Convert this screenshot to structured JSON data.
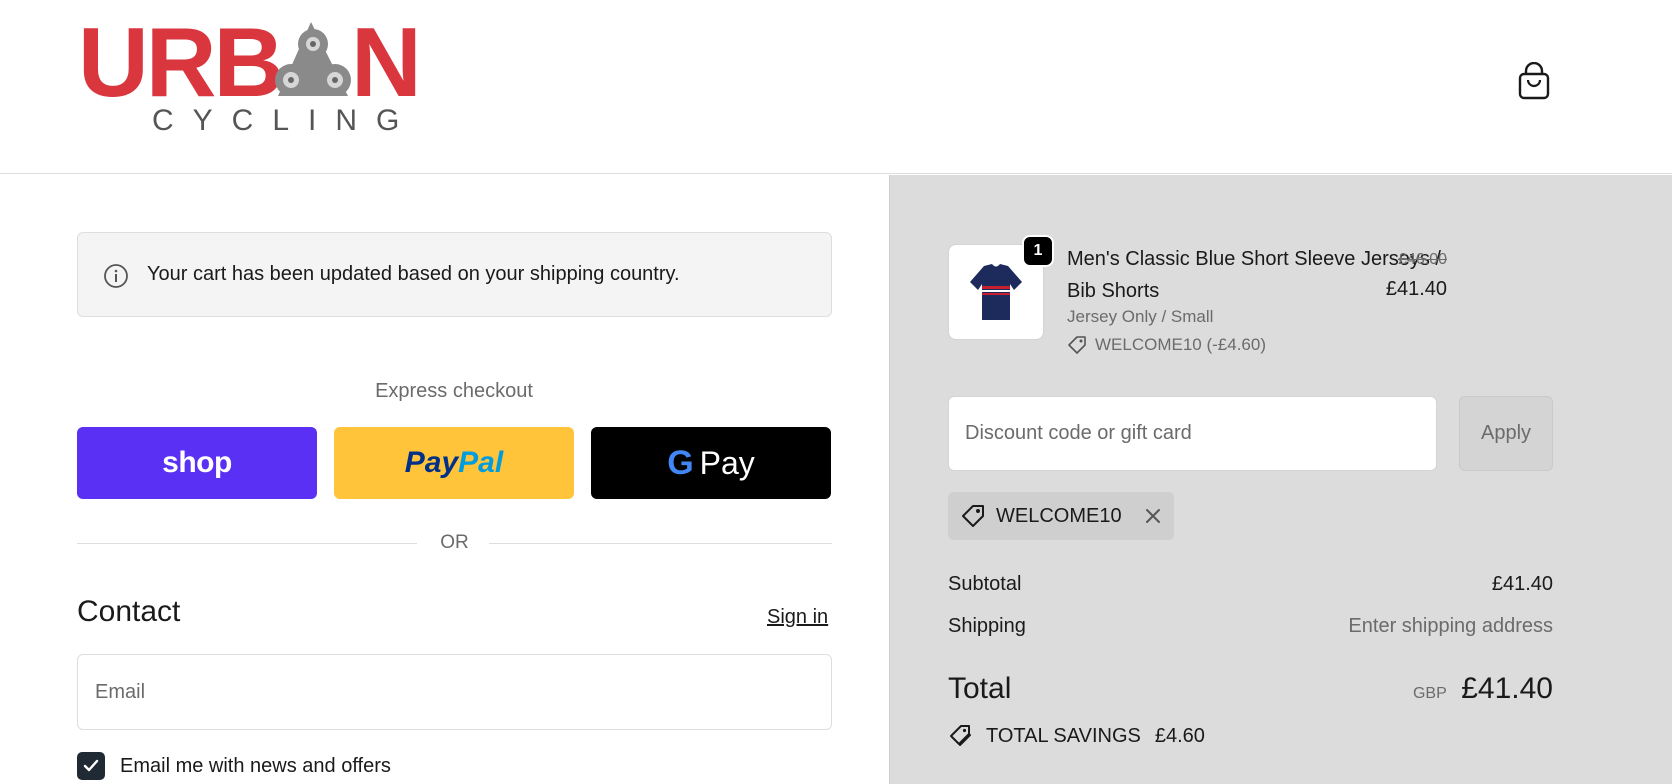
{
  "brand": {
    "name": "URBAN",
    "tagline": "CYCLING",
    "primary_color": "#d9363e"
  },
  "header": {
    "cart_icon": "shopping-bag-icon"
  },
  "notice": {
    "icon": "info-icon",
    "text": "Your cart has been updated based on your shipping country."
  },
  "express": {
    "title": "Express checkout",
    "shop_label": "shop",
    "paypal_label_a": "Pay",
    "paypal_label_b": "Pal",
    "gpay_g": "G",
    "gpay_label": "Pay",
    "or_label": "OR",
    "colors": {
      "shop": "#5a31f4",
      "paypal": "#ffc439",
      "gpay": "#000000"
    }
  },
  "contact": {
    "title": "Contact",
    "sign_in": "Sign in",
    "email_placeholder": "Email",
    "email_value": "",
    "newsletter_label": "Email me with news and offers",
    "newsletter_checked": true
  },
  "order": {
    "item": {
      "quantity": "1",
      "name": "Men's Classic Blue Short Sleeve Jerseys / Bib Shorts",
      "variant": "Jersey Only / Small",
      "discount": "WELCOME10 (-£4.60)",
      "original_price": "£46.00",
      "price": "£41.40"
    },
    "discount_placeholder": "Discount code or gift card",
    "apply_label": "Apply",
    "applied_code": "WELCOME10",
    "subtotal_label": "Subtotal",
    "subtotal_value": "£41.40",
    "shipping_label": "Shipping",
    "shipping_value": "Enter shipping address",
    "total_label": "Total",
    "currency": "GBP",
    "total_value": "£41.40",
    "savings_label": "TOTAL SAVINGS",
    "savings_value": "£4.60"
  }
}
